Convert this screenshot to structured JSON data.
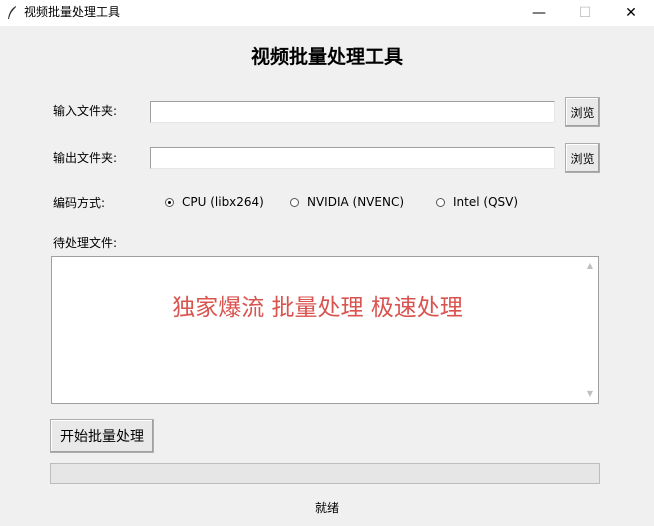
{
  "window": {
    "title": "视频批量处理工具",
    "minimize_glyph": "—",
    "maximize_glyph": "☐",
    "close_glyph": "✕"
  },
  "header": {
    "title": "视频批量处理工具"
  },
  "input_folder": {
    "label": "输入文件夹:",
    "value": "",
    "browse_label": "浏览"
  },
  "output_folder": {
    "label": "输出文件夹:",
    "value": "",
    "browse_label": "浏览"
  },
  "encoding": {
    "label": "编码方式:",
    "options": [
      {
        "label": "CPU (libx264)",
        "selected": true
      },
      {
        "label": "NVIDIA (NVENC)",
        "selected": false
      },
      {
        "label": "Intel (QSV)",
        "selected": false
      }
    ]
  },
  "file_list": {
    "label": "待处理文件:",
    "overlay_text": "独家爆流 批量处理 极速处理",
    "overlay_color": "#d9534f",
    "scroll_up_glyph": "▲",
    "scroll_down_glyph": "▼"
  },
  "actions": {
    "start_label": "开始批量处理"
  },
  "progress": {
    "fraction": 0
  },
  "status": {
    "text": "就绪"
  }
}
